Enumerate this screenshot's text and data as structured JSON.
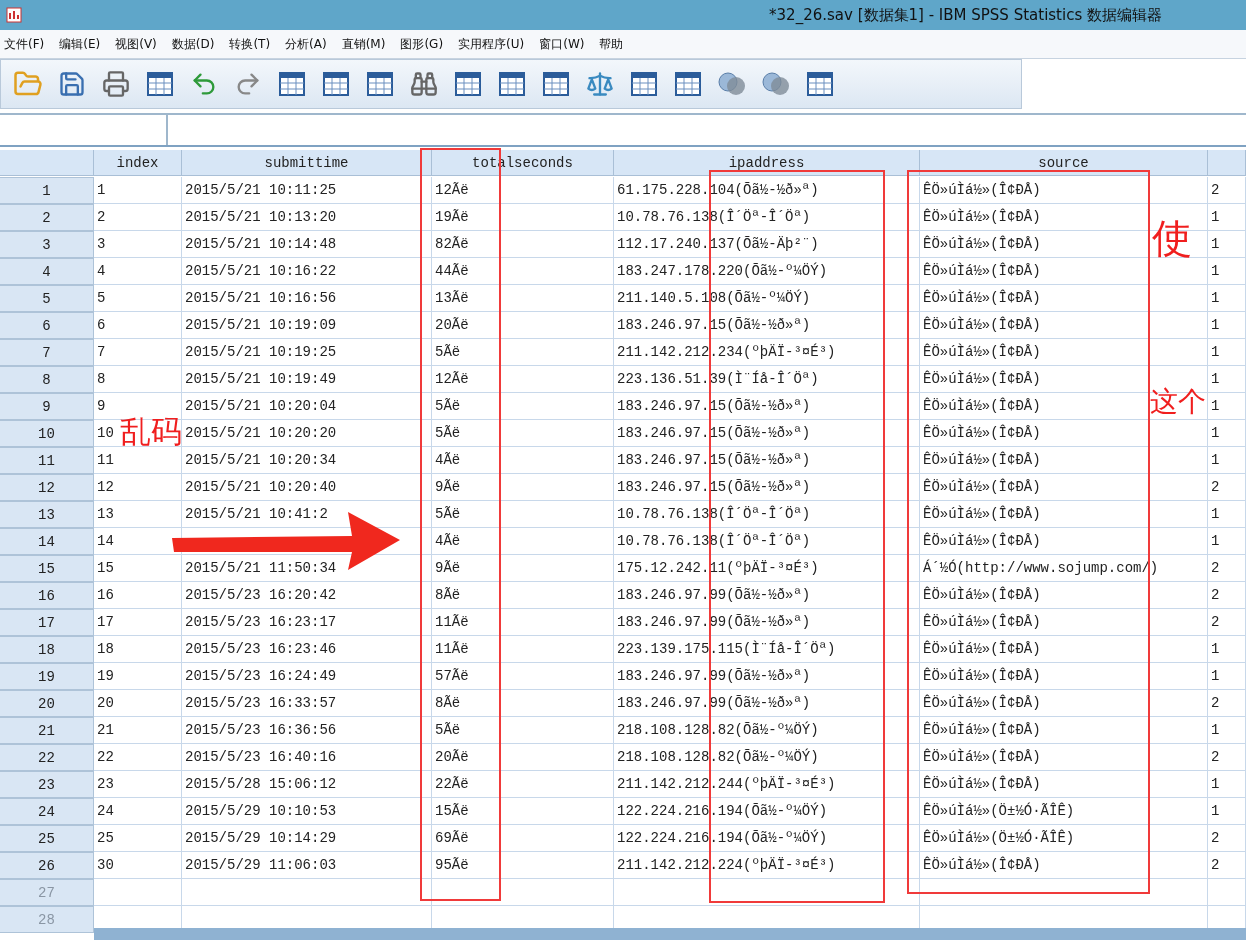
{
  "window": {
    "title": "*32_26.sav [数据集1] - IBM SPSS Statistics 数据编辑器"
  },
  "menu": [
    "文件(F)",
    "编辑(E)",
    "视图(V)",
    "数据(D)",
    "转换(T)",
    "分析(A)",
    "直销(M)",
    "图形(G)",
    "实用程序(U)",
    "窗口(W)",
    "帮助"
  ],
  "table": {
    "columns": [
      "index",
      "submittime",
      "totalseconds",
      "ipaddress",
      "source"
    ],
    "rows": [
      {
        "number": "1",
        "cells": [
          "1",
          "2015/5/21 10:11:25",
          "12Ãë",
          "61.175.228.104(Õã½-½ð»ª)",
          "ÊÖ»úÌá½»(Î¢ÐÅ)",
          "2"
        ]
      },
      {
        "number": "2",
        "cells": [
          "2",
          "2015/5/21 10:13:20",
          "19Ãë",
          "10.78.76.138(Î´Öª-Î´Öª)",
          "ÊÖ»úÌá½»(Î¢ÐÅ)",
          "1"
        ]
      },
      {
        "number": "3",
        "cells": [
          "3",
          "2015/5/21 10:14:48",
          "82Ãë",
          "112.17.240.137(Õã½-Äþ²¨)",
          "ÊÖ»úÌá½»(Î¢ÐÅ)",
          "1"
        ]
      },
      {
        "number": "4",
        "cells": [
          "4",
          "2015/5/21 10:16:22",
          "44Ãë",
          "183.247.178.220(Õã½-º¼ÖÝ)",
          "ÊÖ»úÌá½»(Î¢ÐÅ)",
          "1"
        ]
      },
      {
        "number": "5",
        "cells": [
          "5",
          "2015/5/21 10:16:56",
          "13Ãë",
          "211.140.5.108(Õã½-º¼ÖÝ)",
          "ÊÖ»úÌá½»(Î¢ÐÅ)",
          "1"
        ]
      },
      {
        "number": "6",
        "cells": [
          "6",
          "2015/5/21 10:19:09",
          "20Ãë",
          "183.246.97.15(Õã½-½ð»ª)",
          "ÊÖ»úÌá½»(Î¢ÐÅ)",
          "1"
        ]
      },
      {
        "number": "7",
        "cells": [
          "7",
          "2015/5/21 10:19:25",
          "5Ãë",
          "211.142.212.234(ºþÄÏ-³¤É³)",
          "ÊÖ»úÌá½»(Î¢ÐÅ)",
          "1"
        ]
      },
      {
        "number": "8",
        "cells": [
          "8",
          "2015/5/21 10:19:49",
          "12Ãë",
          "223.136.51.39(Ì¨Íå-Î´Öª)",
          "ÊÖ»úÌá½»(Î¢ÐÅ)",
          "1"
        ]
      },
      {
        "number": "9",
        "cells": [
          "9",
          "2015/5/21 10:20:04",
          "5Ãë",
          "183.246.97.15(Õã½-½ð»ª)",
          "ÊÖ»úÌá½»(Î¢ÐÅ)",
          "1"
        ]
      },
      {
        "number": "10",
        "cells": [
          "10",
          "2015/5/21 10:20:20",
          "5Ãë",
          "183.246.97.15(Õã½-½ð»ª)",
          "ÊÖ»úÌá½»(Î¢ÐÅ)",
          "1"
        ]
      },
      {
        "number": "11",
        "cells": [
          "11",
          "2015/5/21 10:20:34",
          "4Ãë",
          "183.246.97.15(Õã½-½ð»ª)",
          "ÊÖ»úÌá½»(Î¢ÐÅ)",
          "1"
        ]
      },
      {
        "number": "12",
        "cells": [
          "12",
          "2015/5/21 10:20:40",
          "9Ãë",
          "183.246.97.15(Õã½-½ð»ª)",
          "ÊÖ»úÌá½»(Î¢ÐÅ)",
          "2"
        ]
      },
      {
        "number": "13",
        "cells": [
          "13",
          "2015/5/21 10:41:2",
          "5Ãë",
          "10.78.76.138(Î´Öª-Î´Öª)",
          "ÊÖ»úÌá½»(Î¢ÐÅ)",
          "1"
        ]
      },
      {
        "number": "14",
        "cells": [
          "14",
          null,
          "4Ãë",
          "10.78.76.138(Î´Öª-Î´Öª)",
          "ÊÖ»úÌá½»(Î¢ÐÅ)",
          "1"
        ]
      },
      {
        "number": "15",
        "cells": [
          "15",
          "2015/5/21 11:50:34",
          "9Ãë",
          "175.12.242.11(ºþÄÏ-³¤É³)",
          "Á´½Ó(http://www.sojump.com/)",
          "2"
        ]
      },
      {
        "number": "16",
        "cells": [
          "16",
          "2015/5/23 16:20:42",
          "8Ãë",
          "183.246.97.99(Õã½-½ð»ª)",
          "ÊÖ»úÌá½»(Î¢ÐÅ)",
          "2"
        ]
      },
      {
        "number": "17",
        "cells": [
          "17",
          "2015/5/23 16:23:17",
          "11Ãë",
          "183.246.97.99(Õã½-½ð»ª)",
          "ÊÖ»úÌá½»(Î¢ÐÅ)",
          "2"
        ]
      },
      {
        "number": "18",
        "cells": [
          "18",
          "2015/5/23 16:23:46",
          "11Ãë",
          "223.139.175.115(Ì¨Íå-Î´Öª)",
          "ÊÖ»úÌá½»(Î¢ÐÅ)",
          "1"
        ]
      },
      {
        "number": "19",
        "cells": [
          "19",
          "2015/5/23 16:24:49",
          "57Ãë",
          "183.246.97.99(Õã½-½ð»ª)",
          "ÊÖ»úÌá½»(Î¢ÐÅ)",
          "1"
        ]
      },
      {
        "number": "20",
        "cells": [
          "20",
          "2015/5/23 16:33:57",
          "8Ãë",
          "183.246.97.99(Õã½-½ð»ª)",
          "ÊÖ»úÌá½»(Î¢ÐÅ)",
          "2"
        ]
      },
      {
        "number": "21",
        "cells": [
          "21",
          "2015/5/23 16:36:56",
          "5Ãë",
          "218.108.128.82(Õã½-º¼ÖÝ)",
          "ÊÖ»úÌá½»(Î¢ÐÅ)",
          "1"
        ]
      },
      {
        "number": "22",
        "cells": [
          "22",
          "2015/5/23 16:40:16",
          "20Ãë",
          "218.108.128.82(Õã½-º¼ÖÝ)",
          "ÊÖ»úÌá½»(Î¢ÐÅ)",
          "2"
        ]
      },
      {
        "number": "23",
        "cells": [
          "23",
          "2015/5/28 15:06:12",
          "22Ãë",
          "211.142.212.244(ºþÄÏ-³¤É³)",
          "ÊÖ»úÌá½»(Î¢ÐÅ)",
          "1"
        ]
      },
      {
        "number": "24",
        "cells": [
          "24",
          "2015/5/29 10:10:53",
          "15Ãë",
          "122.224.216.194(Õã½-º¼ÖÝ)",
          "ÊÖ»úÌá½»(Ö±½Ó·ÃÎÊ)",
          "1"
        ]
      },
      {
        "number": "25",
        "cells": [
          "25",
          "2015/5/29 10:14:29",
          "69Ãë",
          "122.224.216.194(Õã½-º¼ÖÝ)",
          "ÊÖ»úÌá½»(Ö±½Ó·ÃÎÊ)",
          "2"
        ]
      },
      {
        "number": "26",
        "cells": [
          "30",
          "2015/5/29 11:06:03",
          "95Ãë",
          "211.142.212.224(ºþÄÏ-³¤É³)",
          "ÊÖ»úÌá½»(Î¢ÐÅ)",
          "2"
        ]
      }
    ],
    "empty_rows": [
      "27",
      "28"
    ]
  },
  "annotations": [
    {
      "kind": "box"
    },
    {
      "kind": "box"
    },
    {
      "kind": "box"
    },
    {
      "kind": "arrow"
    },
    {
      "kind": "label",
      "text": "乱码"
    },
    {
      "kind": "label",
      "text": "使"
    },
    {
      "kind": "label",
      "text": "这个"
    }
  ]
}
